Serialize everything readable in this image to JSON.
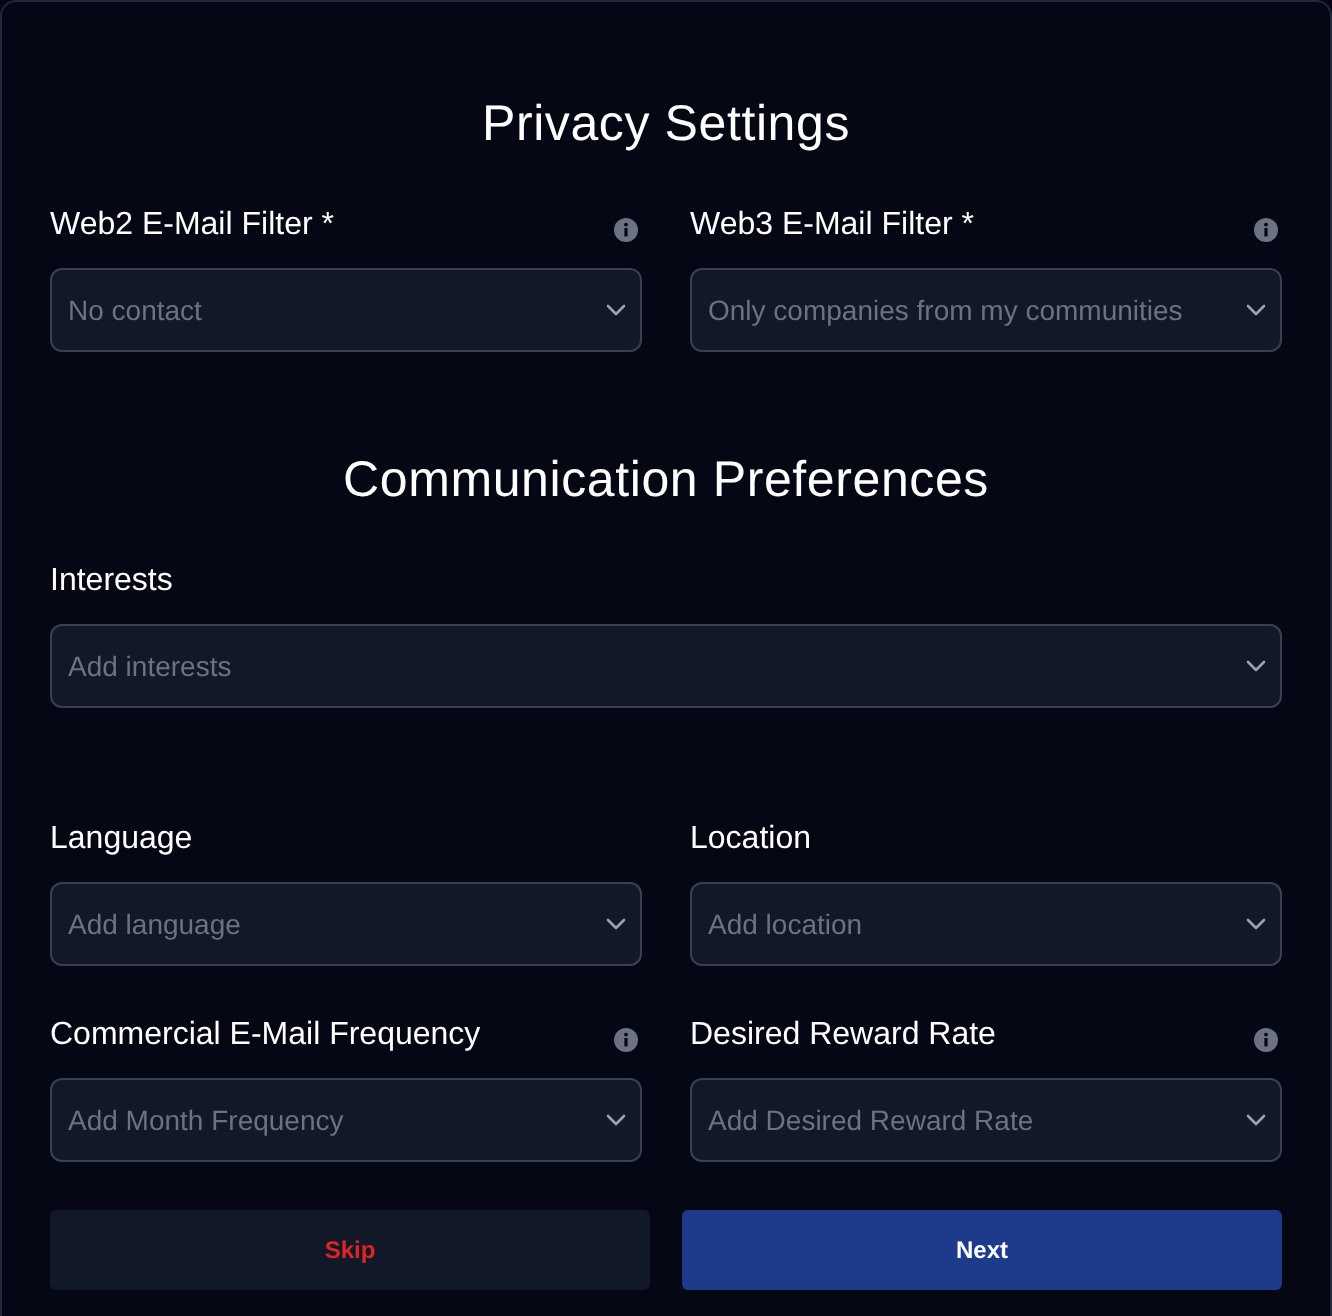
{
  "sections": [
    {
      "title": "Privacy Settings",
      "rows": [
        [
          {
            "label": "Web2 E-Mail Filter *",
            "placeholder": "No contact",
            "info": true
          },
          {
            "label": "Web3 E-Mail Filter *",
            "placeholder": "Only companies from my communities",
            "info": true
          }
        ]
      ]
    },
    {
      "title": "Communication Preferences",
      "rows": [
        [
          {
            "label": "Interests",
            "placeholder": "Add interests",
            "info": false
          }
        ],
        [
          {
            "label": "Language",
            "placeholder": "Add language",
            "info": false
          },
          {
            "label": "Location",
            "placeholder": "Add location",
            "info": false
          }
        ],
        [
          {
            "label": "Commercial E-Mail Frequency",
            "placeholder": "Add Month Frequency",
            "info": true
          },
          {
            "label": "Desired Reward Rate",
            "placeholder": "Add Desired Reward Rate",
            "info": true
          }
        ]
      ]
    }
  ],
  "buttons": [
    {
      "label": "Skip",
      "kind": "secondary"
    },
    {
      "label": "Next",
      "kind": "primary"
    }
  ]
}
